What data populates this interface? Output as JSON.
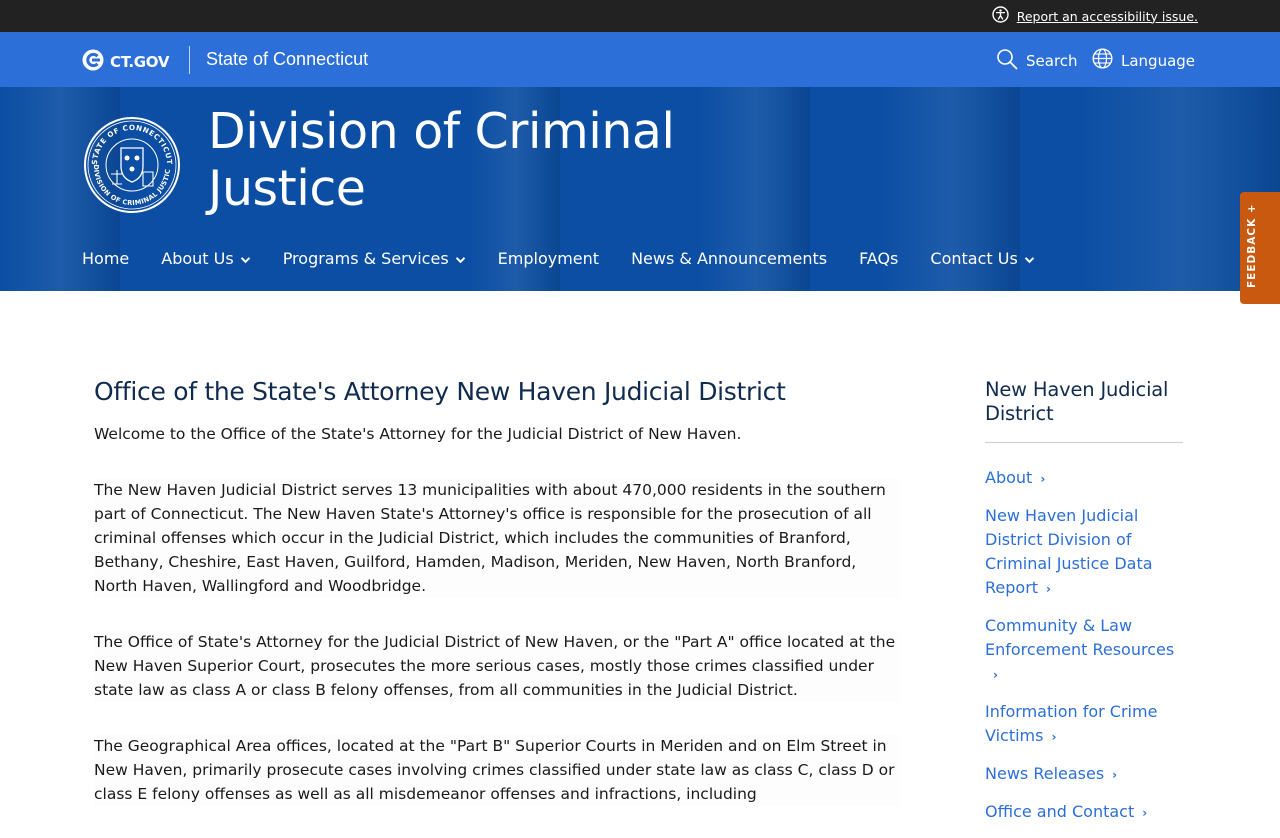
{
  "utility_bar": {
    "accessibility_link": "Report an accessibility issue."
  },
  "ct_bar": {
    "logo_text": "CT.GOV",
    "state_name": "State of Connecticut",
    "search_label": "Search",
    "language_label": "Language"
  },
  "hero": {
    "title_line1": "Division of Criminal",
    "title_line2": "Justice",
    "seal_top_text": "STATE OF CONNECTICUT",
    "seal_bottom_text": "DIVISION OF CRIMINAL JUSTICE"
  },
  "nav": {
    "items": [
      {
        "label": "Home",
        "has_dropdown": false
      },
      {
        "label": "About Us",
        "has_dropdown": true
      },
      {
        "label": "Programs & Services",
        "has_dropdown": true
      },
      {
        "label": "Employment",
        "has_dropdown": false
      },
      {
        "label": "News & Announcements",
        "has_dropdown": false
      },
      {
        "label": "FAQs",
        "has_dropdown": false
      },
      {
        "label": "Contact Us",
        "has_dropdown": true
      }
    ]
  },
  "feedback_tab": "FEEDBACK +",
  "main": {
    "heading": "Office of the State's Attorney New Haven Judicial District",
    "intro": "Welcome to the Office of the State's Attorney for the Judicial District of New Haven.",
    "paragraphs": [
      "The New Haven Judicial District serves 13 municipalities with about 470,000 residents in the southern part of Connecticut. The New Haven State's Attorney's office is responsible for the prosecution of all criminal offenses which occur in the Judicial District, which includes the communities of Branford, Bethany, Cheshire, East Haven, Guilford, Hamden, Madison, Meriden, New Haven, North Branford, North Haven, Wallingford and Woodbridge.",
      "The Office of State's Attorney for the Judicial District of New Haven, or the \"Part A\" office located at the New Haven Superior Court, prosecutes the more serious cases, mostly those crimes classified under state law as class A or class B felony offenses, from all communities in the Judicial District.",
      "The Geographical Area offices, located at the \"Part B\" Superior Courts in Meriden and on Elm Street in New Haven, primarily prosecute cases involving crimes classified under state law as class C, class D or class E felony offenses as well as all misdemeanor offenses and infractions, including"
    ]
  },
  "sidebar": {
    "heading": "New Haven Judicial District",
    "links": [
      "About",
      "New Haven Judicial District Division of Criminal Justice Data Report",
      "Community & Law Enforcement Resources",
      "Information for Crime Victims",
      "News Releases",
      "Office and Contact"
    ]
  },
  "colors": {
    "utility_bar": "#222222",
    "ct_bar": "#2c6fd8",
    "hero": "#0b4ea3",
    "feedback": "#c9590f",
    "heading": "#102b4e",
    "link": "#2c6fd8"
  }
}
